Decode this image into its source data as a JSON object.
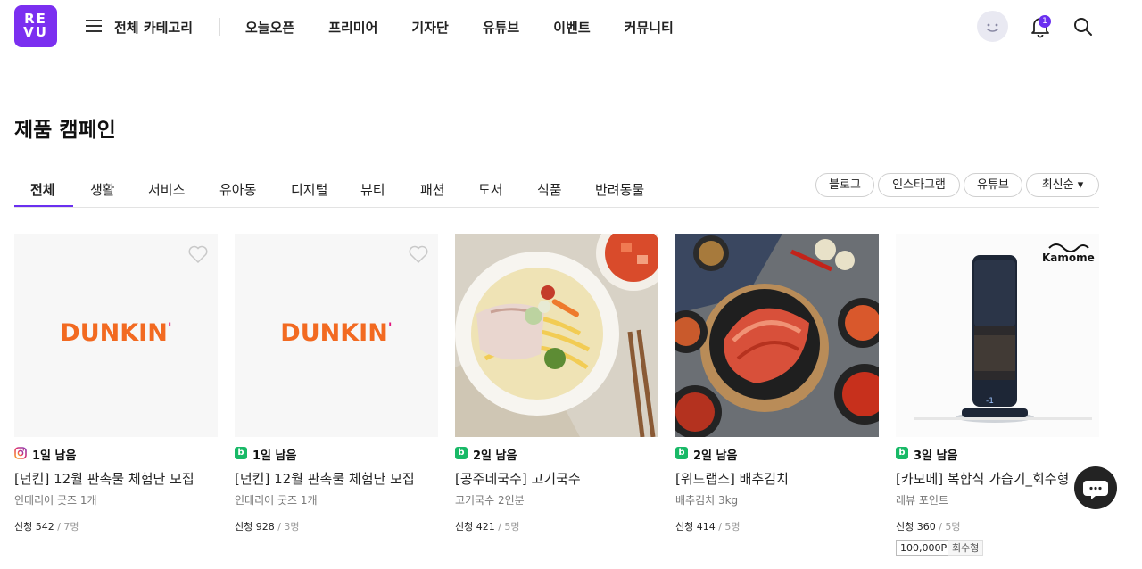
{
  "header": {
    "logo_top": "RE",
    "logo_bottom": "VU",
    "all_category": "전체 카테고리",
    "nav": [
      "오늘오픈",
      "프리미어",
      "기자단",
      "유튜브",
      "이벤트",
      "커뮤니티"
    ],
    "notification_count": "1"
  },
  "page_title": "제품 캠페인",
  "tabs": [
    "전체",
    "생활",
    "서비스",
    "유아동",
    "디지털",
    "뷰티",
    "패션",
    "도서",
    "식품",
    "반려동물"
  ],
  "active_tab": "전체",
  "filters": [
    "블로그",
    "인스타그램",
    "유튜브",
    "최신순 ▾"
  ],
  "cards": [
    {
      "channel": "instagram",
      "days": "1일 남음",
      "title": "[던킨] 12월 판촉물 체험단 모집",
      "sub": "인테리어 굿즈 1개",
      "apply_label": "신청 542",
      "capacity": " / 7명",
      "brand": "DUNKIN",
      "brand_mark": "'"
    },
    {
      "channel": "blog",
      "days": "1일 남음",
      "title": "[던킨] 12월 판촉물 체험단 모집",
      "sub": "인테리어 굿즈 1개",
      "apply_label": "신청 928",
      "capacity": " / 3명",
      "brand": "DUNKIN",
      "brand_mark": "'"
    },
    {
      "channel": "blog",
      "days": "2일 남음",
      "title": "[공주네국수] 고기국수",
      "sub": "고기국수 2인분",
      "apply_label": "신청 421",
      "capacity": " / 5명"
    },
    {
      "channel": "blog",
      "days": "2일 남음",
      "title": "[위드랩스] 배추김치",
      "sub": "배추김치 3kg",
      "apply_label": "신청 414",
      "capacity": " / 5명"
    },
    {
      "channel": "blog",
      "days": "3일 남음",
      "title": "[카모메] 복합식 가습기_회수형",
      "sub": "레뷰 포인트",
      "apply_label": "신청 360",
      "capacity": " / 5명",
      "brand": "Kamome",
      "tags": [
        "100,000P",
        "회수형"
      ]
    }
  ],
  "channel_badge_letter": "b",
  "colors": {
    "accent": "#6a2ff0",
    "logo": "#7b2ff0",
    "dunkin": "#f26a21",
    "blog_badge": "#19b967"
  }
}
